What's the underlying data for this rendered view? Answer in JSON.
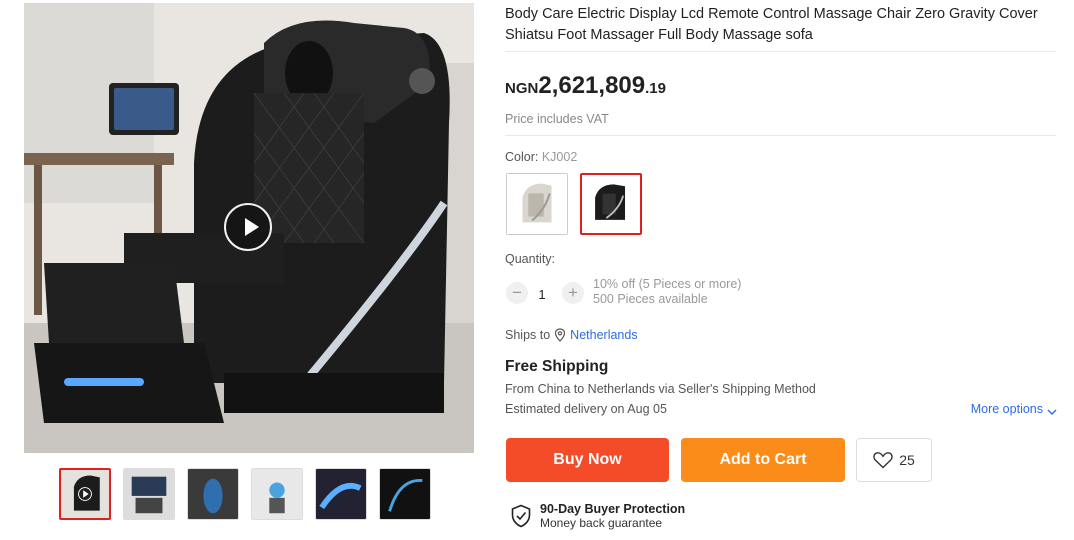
{
  "product": {
    "title": "Body Care Electric Display Lcd Remote Control Massage Chair Zero Gravity Cover Shiatsu Foot Massager Full Body Massage sofa",
    "price": {
      "currency": "NGN",
      "integer": "2,621,809",
      "decimal": ".19"
    },
    "vat_note": "Price includes VAT"
  },
  "gallery": {
    "thumbnails": [
      "thumb-1",
      "thumb-2",
      "thumb-3",
      "thumb-4",
      "thumb-5",
      "thumb-6"
    ],
    "active_index": 0
  },
  "color": {
    "label": "Color:",
    "selected": "KJ002",
    "options": [
      {
        "name": "white-chair",
        "selected": false
      },
      {
        "name": "black-chair",
        "selected": true
      }
    ]
  },
  "quantity": {
    "label": "Quantity:",
    "value": "1",
    "minus": "−",
    "plus": "+",
    "discount": "10% off (5 Pieces or more)",
    "available": "500 Pieces available"
  },
  "shipping": {
    "ships_to_label": "Ships to",
    "destination": "Netherlands",
    "free_shipping": "Free Shipping",
    "route": "From China to Netherlands via Seller's Shipping Method",
    "delivery": "Estimated delivery on Aug 05",
    "more_options": "More options"
  },
  "actions": {
    "buy_now": "Buy Now",
    "add_to_cart": "Add to Cart",
    "wishlist_count": "25"
  },
  "protection": {
    "title": "90-Day Buyer Protection",
    "subtitle": "Money back guarantee"
  },
  "colors": {
    "buy_now": "#f44b28",
    "add_to_cart": "#fb8c1a",
    "link": "#2e6be6",
    "selected_border": "#e02020"
  }
}
